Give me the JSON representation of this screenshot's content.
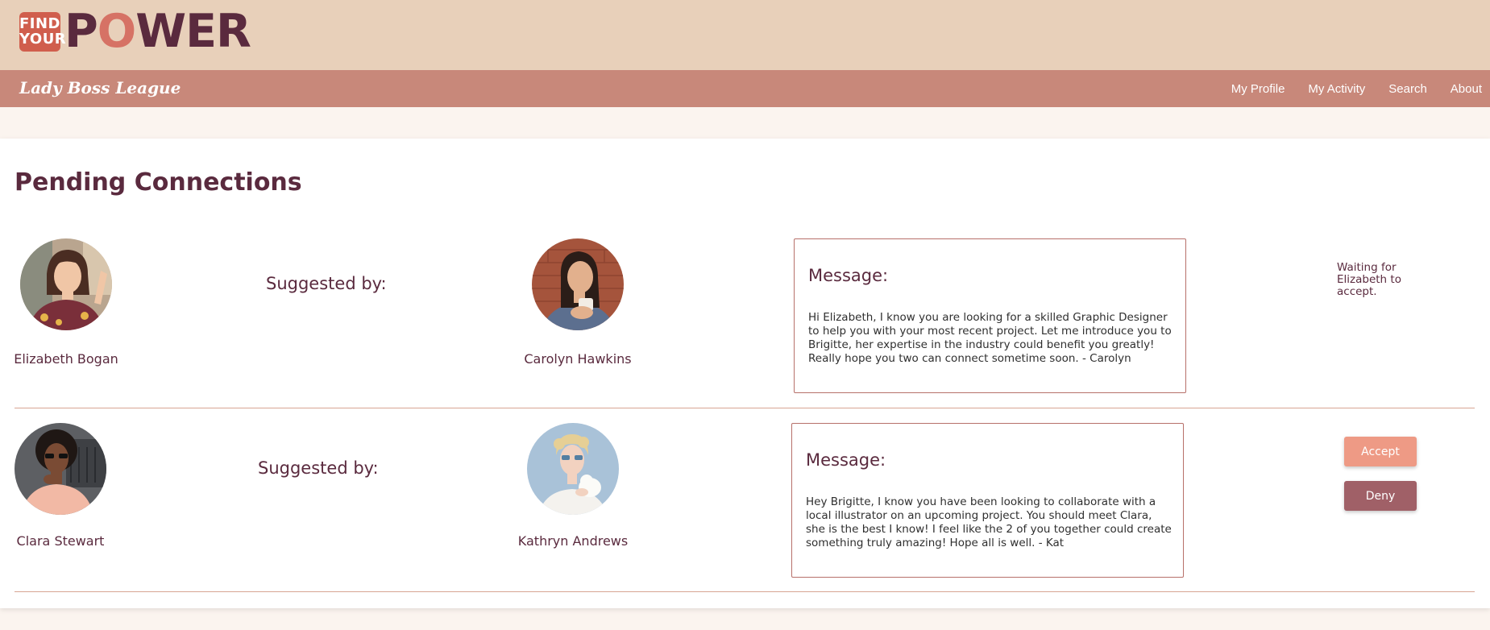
{
  "logo": {
    "find": "FIND",
    "your": "YOUR",
    "word_p": "P",
    "word_o": "O",
    "word_rest": "WER"
  },
  "nav": {
    "brand": "Lady Boss League",
    "links": [
      "My Profile",
      "My Activity",
      "Search",
      "About"
    ]
  },
  "page_title": "Pending Connections",
  "connections": [
    {
      "person": "Elizabeth Bogan",
      "suggested_label": "Suggested by:",
      "suggester": "Carolyn Hawkins",
      "message_heading": "Message:",
      "message": "Hi Elizabeth, I know you are looking for a skilled Graphic Designer to help you with your most recent project. Let me introduce you to Brigitte, her expertise in the industry could benefit you greatly! Really hope you two can connect sometime soon. - Carolyn",
      "status": "Waiting for Elizabeth to accept."
    },
    {
      "person": "Clara Stewart",
      "suggested_label": "Suggested by:",
      "suggester": "Kathryn Andrews",
      "message_heading": "Message:",
      "message": "Hey Brigitte, I know you have been looking to collaborate with a local illustrator on an upcoming project. You should meet Clara, she is the best I know! I feel like the 2 of you together could create something truly amazing! Hope all is well. - Kat",
      "accept_label": "Accept",
      "deny_label": "Deny"
    }
  ],
  "colors": {
    "banner": "#e8d0ba",
    "nav": "#c8887a",
    "plum": "#5a2a3e",
    "accept": "#ee9a85",
    "deny": "#a06067"
  }
}
